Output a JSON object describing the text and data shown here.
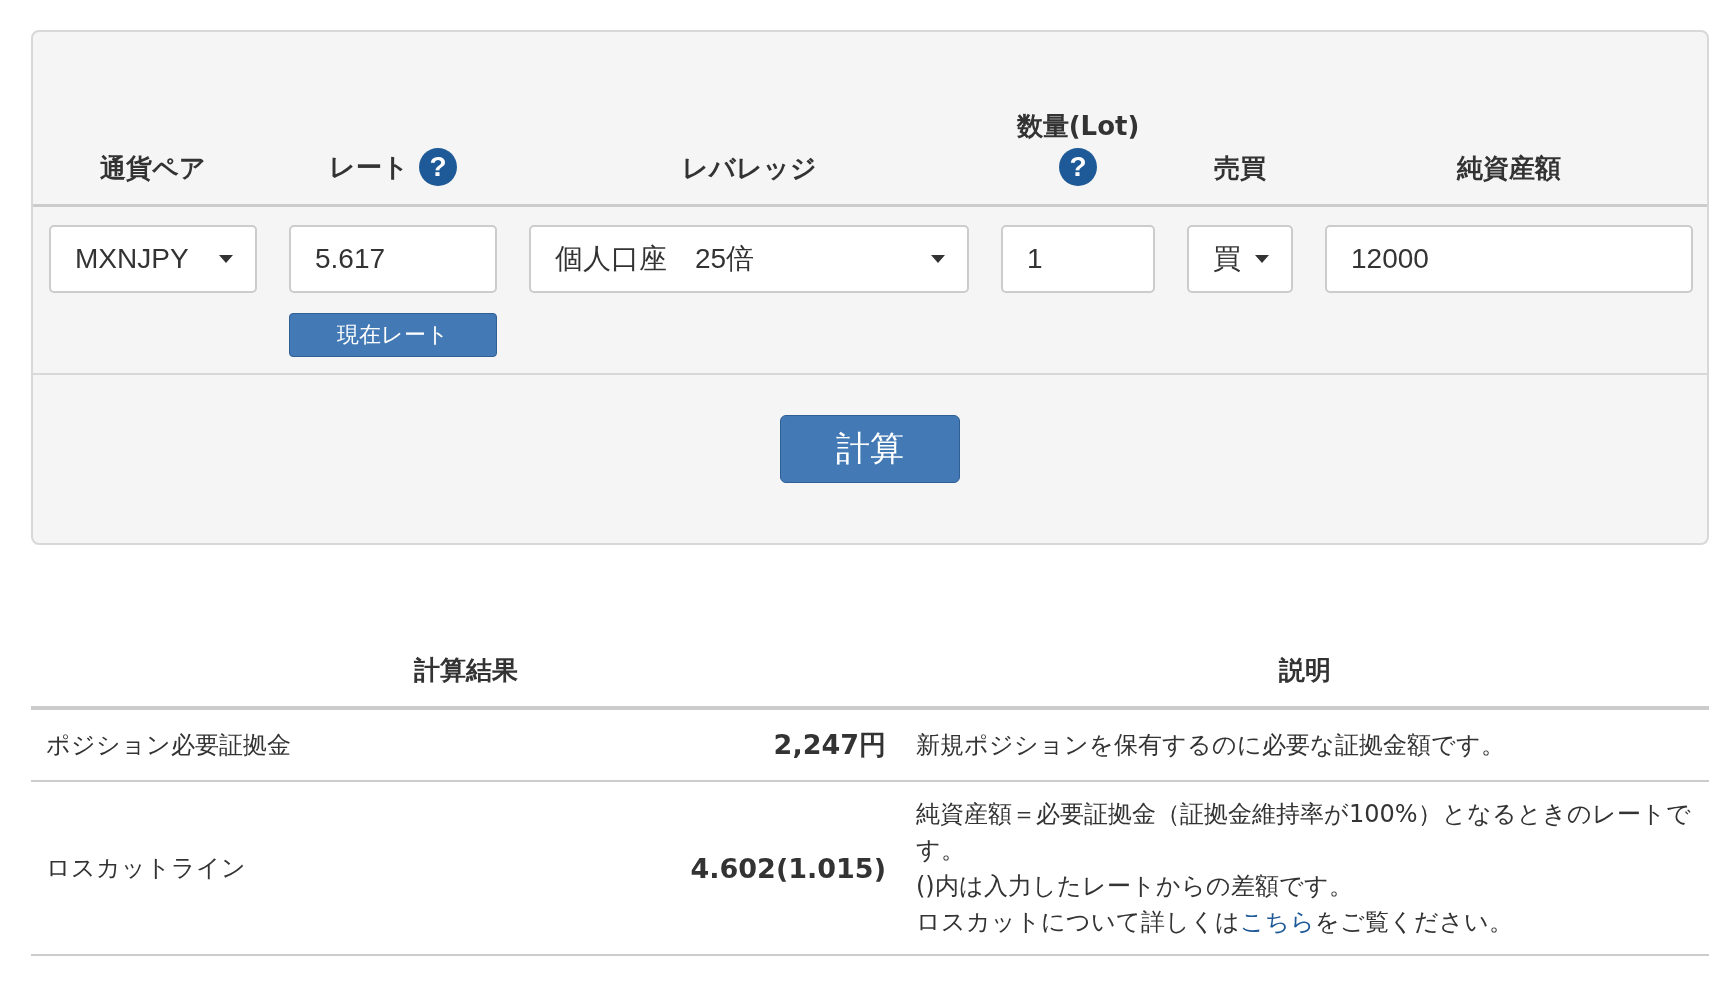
{
  "form": {
    "columns": [
      {
        "label": "通貨ペア",
        "field": {
          "kind": "select",
          "value": "MXNJPY"
        }
      },
      {
        "label": "レート",
        "help": "?",
        "field": {
          "kind": "input",
          "value": "5.617"
        },
        "action": "現在レート"
      },
      {
        "label": "レバレッジ",
        "field": {
          "kind": "select",
          "value": "個人口座　25倍"
        }
      },
      {
        "label": "数量(Lot)",
        "help": "?",
        "field": {
          "kind": "input",
          "value": "1"
        }
      },
      {
        "label": "売買",
        "field": {
          "kind": "select",
          "value": "買"
        }
      },
      {
        "label": "純資産額",
        "field": {
          "kind": "input",
          "value": "12000"
        }
      }
    ],
    "submit": "計算"
  },
  "results": {
    "columns": [
      "計算結果",
      "説明"
    ],
    "rows": [
      {
        "name": "ポジション必要証拠金",
        "value": "2,247円",
        "description": [
          {
            "text": "新規ポジションを保有するのに必要な証拠金額です。"
          }
        ]
      },
      {
        "name": "ロスカットライン",
        "value": "4.602(1.015)",
        "description": [
          {
            "text": "純資産額＝必要証拠金（証拠金維持率が100%）となるときのレートです。"
          },
          {
            "text": "()内は入力したレートからの差額です。"
          },
          {
            "text": "ロスカットについて詳しくは",
            "link": "こちら",
            "after": "をご覧ください。"
          }
        ]
      }
    ]
  }
}
